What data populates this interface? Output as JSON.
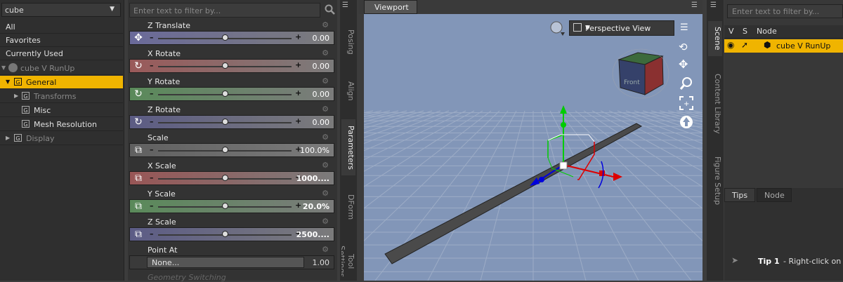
{
  "left_panel": {
    "selector_value": "cube",
    "items": [
      {
        "label": "All"
      },
      {
        "label": "Favorites"
      },
      {
        "label": "Currently Used"
      },
      {
        "label": "cube V RunUp"
      },
      {
        "label": "General"
      },
      {
        "label": "Transforms"
      },
      {
        "label": "Misc"
      },
      {
        "label": "Mesh Resolution"
      },
      {
        "label": "Display"
      }
    ]
  },
  "params_panel": {
    "filter_placeholder": "Enter text to filter by...",
    "params": [
      {
        "name": "Z Translate",
        "value": "0.00",
        "icon": "translate-icon",
        "color": "#6a6a9a",
        "knob": 0.5
      },
      {
        "name": "X Rotate",
        "value": "0.00",
        "icon": "rotate-icon",
        "color": "#9a5a5a",
        "knob": 0.5
      },
      {
        "name": "Y Rotate",
        "value": "0.00",
        "icon": "rotate-icon",
        "color": "#5a8a5a",
        "knob": 0.5
      },
      {
        "name": "Z Rotate",
        "value": "0.00",
        "icon": "rotate-icon",
        "color": "#5c5c84",
        "knob": 0.5
      },
      {
        "name": "Scale",
        "value": "100.0%",
        "icon": "scale-icon",
        "color": "#606060",
        "knob": 0.5
      },
      {
        "name": "X Scale",
        "value": "1000....",
        "icon": "scale-icon",
        "color": "#985656",
        "knob": 0.5
      },
      {
        "name": "Y Scale",
        "value": "20.0%",
        "icon": "scale-icon",
        "color": "#5a8a5a",
        "knob": 0.5
      },
      {
        "name": "Z Scale",
        "value": "2500....",
        "icon": "scale-icon",
        "color": "#5c5c86",
        "knob": 0.5
      }
    ],
    "point_at": {
      "name": "Point At",
      "value": "None...",
      "number": "1.00"
    },
    "faded_next": "Geometry Switching"
  },
  "side_tabs": [
    "Posing",
    "Align",
    "Parameters",
    "DForm",
    "Tool Settings"
  ],
  "viewport": {
    "tab_label": "Viewport",
    "view_mode": "Perspective View"
  },
  "right_side_tabs": [
    "Scene",
    "Content Library",
    "Figure Setup"
  ],
  "scene_panel": {
    "filter_placeholder": "Enter text to filter by...",
    "columns": [
      "V",
      "S",
      "Node"
    ],
    "row_label": "cube V RunUp",
    "tabs": [
      "Tips",
      "Node"
    ],
    "tip_label": "Tip 1",
    "tip_text": " - Right-click on a"
  },
  "colors": {
    "highlight": "#f0b400",
    "viewport_bg": "#8296b8"
  }
}
